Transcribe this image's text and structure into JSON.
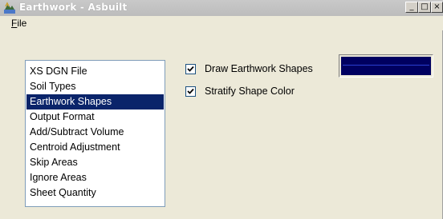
{
  "window": {
    "title": "Earthwork - Asbuilt",
    "controls": {
      "minimize": "_",
      "maximize": "□",
      "close": "×"
    }
  },
  "menu": {
    "file_first": "F",
    "file_rest": "ile"
  },
  "categories": {
    "selected_index": 2,
    "items": [
      "XS DGN File",
      "Soil Types",
      "Earthwork Shapes",
      "Output Format",
      "Add/Subtract Volume",
      "Centroid Adjustment",
      "Skip Areas",
      "Ignore Areas",
      "Sheet Quantity"
    ]
  },
  "options": {
    "draw_shapes": {
      "label": "Draw Earthwork Shapes",
      "checked": true
    },
    "stratify": {
      "label": "Stratify Shape Color",
      "checked": true
    },
    "shape_color": {
      "fill": "#000060",
      "line": "#2b3fd0"
    }
  },
  "icons": {
    "app": "earthwork-app-icon",
    "check": "checkmark-icon"
  }
}
